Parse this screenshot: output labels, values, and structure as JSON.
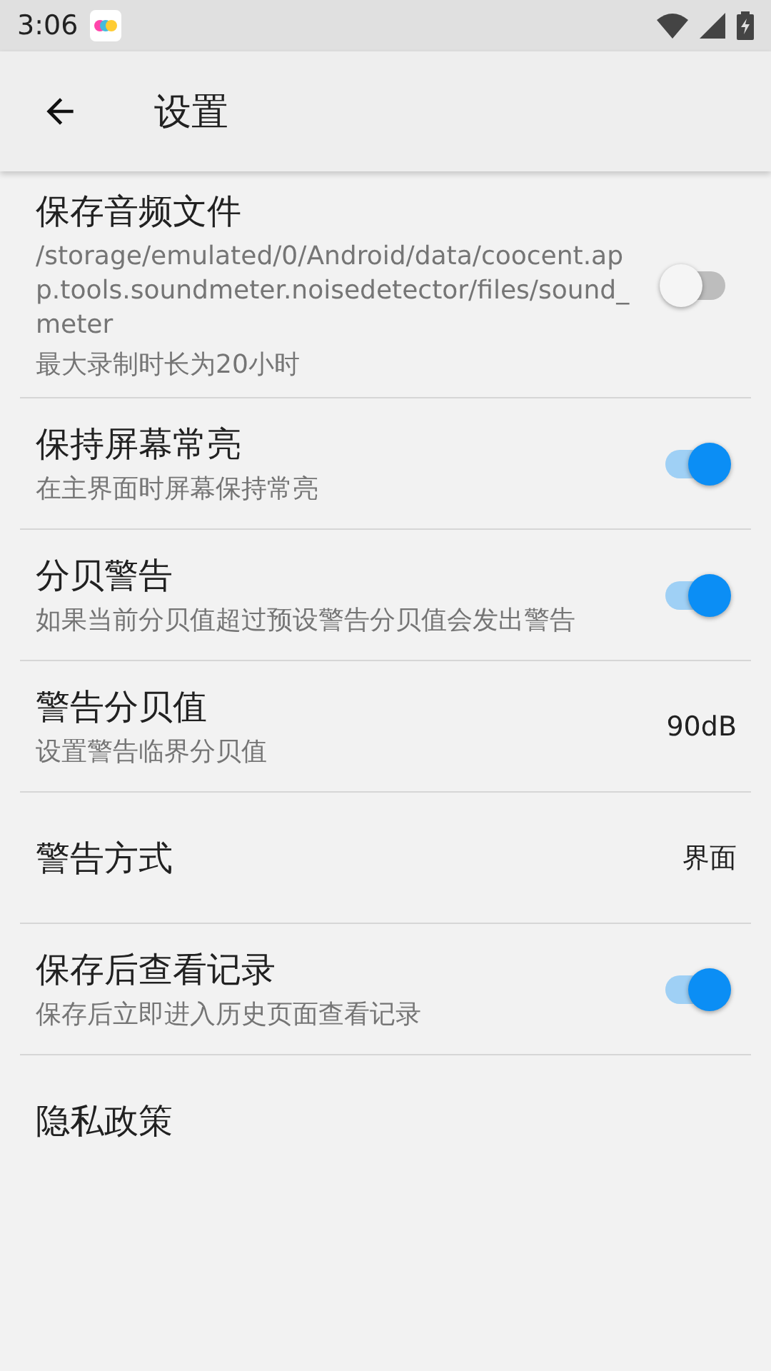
{
  "status_bar": {
    "time": "3:06"
  },
  "app_bar": {
    "title": "设置"
  },
  "settings": [
    {
      "kind": "switch",
      "title": "保存音频文件",
      "summary": [
        "/storage/emulated/0/Android/data/coocent.app.tools.soundmeter.noisedetector/files/sound_meter",
        "最大录制时长为20小时"
      ],
      "on": false
    },
    {
      "kind": "switch",
      "title": "保持屏幕常亮",
      "summary": [
        "在主界面时屏幕保持常亮"
      ],
      "on": true
    },
    {
      "kind": "switch",
      "title": "分贝警告",
      "summary": [
        "如果当前分贝值超过预设警告分贝值会发出警告"
      ],
      "on": true
    },
    {
      "kind": "value",
      "title": "警告分贝值",
      "summary": [
        "设置警告临界分贝值"
      ],
      "value": "90dB"
    },
    {
      "kind": "value",
      "title": "警告方式",
      "value": "界面"
    },
    {
      "kind": "switch",
      "title": "保存后查看记录",
      "summary": [
        "保存后立即进入历史页面查看记录"
      ],
      "on": true
    },
    {
      "kind": "plain",
      "title": "隐私政策"
    }
  ]
}
